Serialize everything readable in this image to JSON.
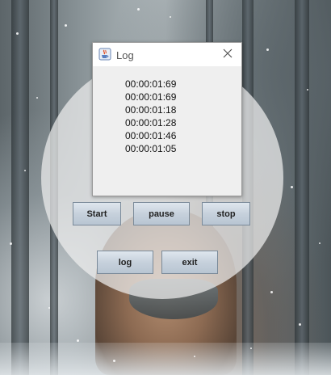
{
  "log_window": {
    "title": "Log",
    "entries": [
      "00:00:01:69",
      "00:00:01:69",
      "00:00:01:18",
      "00:00:01:28",
      "00:00:01:46",
      "00:00:01:05"
    ]
  },
  "buttons": {
    "start": "Start",
    "pause": "pause",
    "stop": "stop",
    "log": "log",
    "exit": "exit"
  },
  "colors": {
    "button_top": "#dfe6ee",
    "button_bottom": "#b8c5d2",
    "overlay_circle": "#eeeeee"
  }
}
